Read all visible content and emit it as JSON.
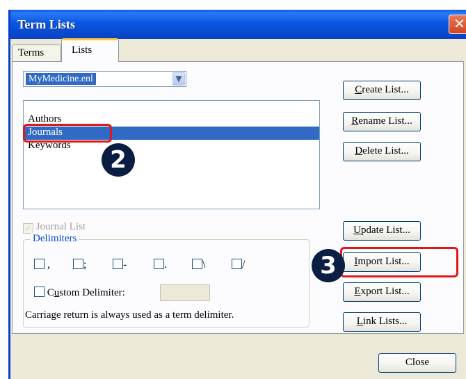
{
  "window": {
    "title": "Term Lists",
    "close_glyph": "✕"
  },
  "tabs": [
    {
      "label": "Terms",
      "selected": false
    },
    {
      "label": "Lists",
      "selected": true
    }
  ],
  "library_select": {
    "value": "MyMedicine.enl",
    "arrow_icon": "chevron-down-icon"
  },
  "lists": [
    {
      "label": "Authors",
      "selected": false
    },
    {
      "label": "Journals",
      "selected": true
    },
    {
      "label": "Keywords",
      "selected": false
    }
  ],
  "buttons": {
    "create": {
      "mnemonic": "C",
      "rest": "reate List..."
    },
    "rename": {
      "mnemonic": "R",
      "rest": "ename List..."
    },
    "delete": {
      "mnemonic": "D",
      "rest": "elete List..."
    },
    "update": {
      "mnemonic": "U",
      "rest": "pdate List..."
    },
    "import": {
      "mnemonic": "I",
      "rest": "mport List..."
    },
    "export": {
      "mnemonic": "E",
      "rest": "xport List..."
    },
    "link": {
      "mnemonic": "L",
      "rest": "ink Lists..."
    },
    "close": {
      "label": "Close"
    }
  },
  "journal_list": {
    "label": "Journal List",
    "checked": true,
    "enabled": false
  },
  "delimiters": {
    "group_label": "Delimiters",
    "items": [
      ",",
      ";",
      "-",
      ".",
      "\\",
      "/"
    ],
    "custom_prefix": "C",
    "custom_mnemonic": "u",
    "custom_rest": "stom Delimiter:",
    "note": "Carriage return is always used as a term delimiter."
  },
  "annotations": {
    "step2": "2",
    "step3": "3",
    "highlight_color": "#e01818"
  }
}
